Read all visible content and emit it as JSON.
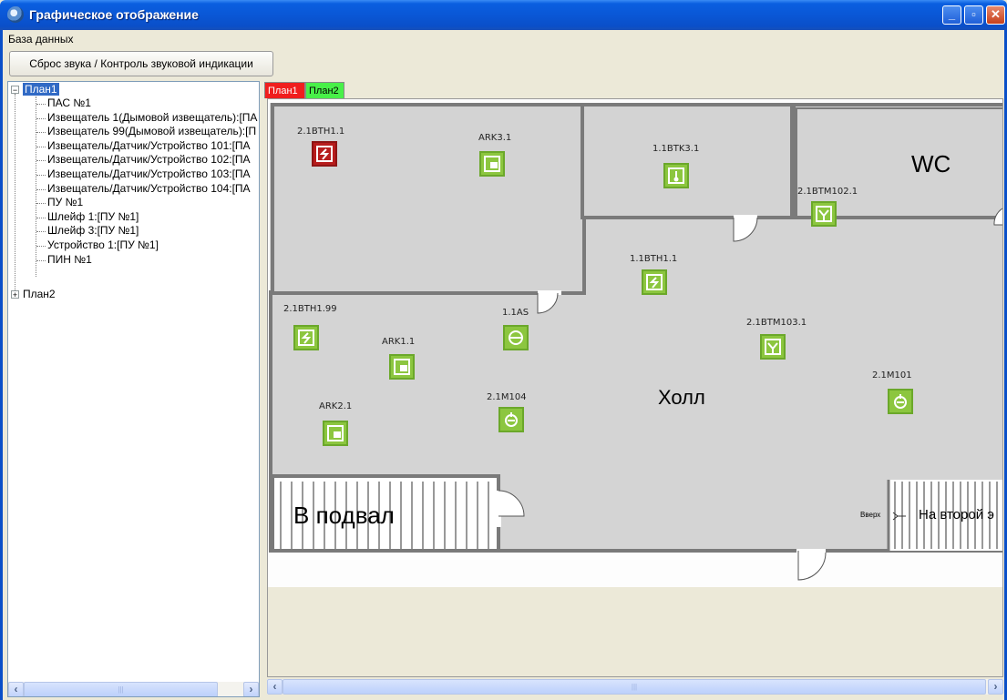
{
  "window": {
    "title": "Графическое отображение",
    "min": "_",
    "max": "▫",
    "close": "✕"
  },
  "menu": {
    "database": "База данных"
  },
  "toolbar": {
    "reset_sound": "Сброс звука / Контроль  звуковой индикации"
  },
  "tree": {
    "root1": "План1",
    "root2": "План2",
    "items": [
      "ПАС №1",
      "Извещатель 1(Дымовой извещатель):[ПА",
      "Извещатель 99(Дымовой извещатель):[П",
      "Извещатель/Датчик/Устройство 101:[ПА",
      "Извещатель/Датчик/Устройство 102:[ПА",
      "Извещатель/Датчик/Устройство 103:[ПА",
      "Извещатель/Датчик/Устройство 104:[ПА",
      "ПУ №1",
      "Шлейф 1:[ПУ №1]",
      "Шлейф 3:[ПУ №1]",
      "Устройство 1:[ПУ №1]",
      "ПИН №1"
    ]
  },
  "tabs": {
    "plan1": "План1",
    "plan2": "План2"
  },
  "plan": {
    "rooms": {
      "wc": "WC",
      "hall": "Холл",
      "basement": "В подвал",
      "second_floor": "На второй э",
      "up": "Вверх"
    },
    "devices": {
      "d1": "2.1BTH1.1",
      "d2": "ARK3.1",
      "d3": "1.1BTK3.1",
      "d4": "2.1BTM102.1",
      "d5": "1.1BTH1.1",
      "d6": "2.1BTH1.99",
      "d7": "1.1AS",
      "d8": "2.1BTM103.1",
      "d9": "ARK1.1",
      "d10": "2.1M101",
      "d11": "2.1M104",
      "d12": "ARK2.1"
    }
  },
  "colors": {
    "alarm": "#b71c1c",
    "normal": "#8cc63f",
    "tab1": "#f01e1e",
    "tab2": "#48f048"
  }
}
